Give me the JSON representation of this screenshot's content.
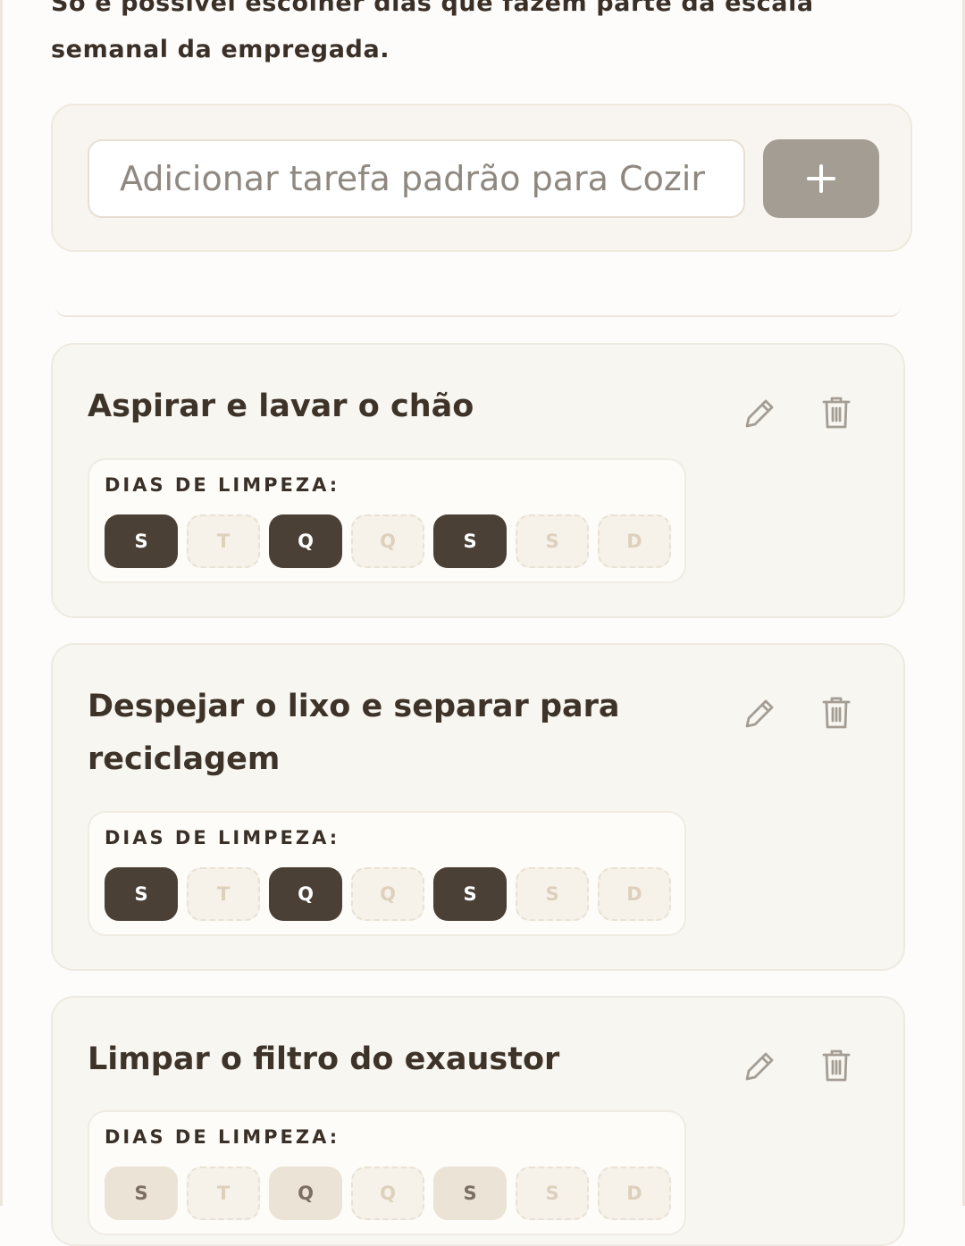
{
  "instructions": {
    "note": "Só é possível escolher dias que fazem parte da escala semanal da empregada."
  },
  "add_task": {
    "placeholder": "Adicionar tarefa padrão para Cozir",
    "button_icon": "plus-icon"
  },
  "colors": {
    "selected_day": "#4b4036",
    "unselected_day": "#f6f2ea",
    "add_button": "#a39d94",
    "card_background": "#f8f6f1"
  },
  "tasks": [
    {
      "title": "Aspirar e lavar o chão",
      "days_label": "DIAS DE LIMPEZA:",
      "days": [
        {
          "letter": "S",
          "state": "selected"
        },
        {
          "letter": "T",
          "state": "unavailable"
        },
        {
          "letter": "Q",
          "state": "selected"
        },
        {
          "letter": "Q",
          "state": "unavailable"
        },
        {
          "letter": "S",
          "state": "selected"
        },
        {
          "letter": "S",
          "state": "unavailable"
        },
        {
          "letter": "D",
          "state": "unavailable"
        }
      ]
    },
    {
      "title": "Despejar o lixo e separar para reciclagem",
      "days_label": "DIAS DE LIMPEZA:",
      "days": [
        {
          "letter": "S",
          "state": "selected"
        },
        {
          "letter": "T",
          "state": "unavailable"
        },
        {
          "letter": "Q",
          "state": "selected"
        },
        {
          "letter": "Q",
          "state": "unavailable"
        },
        {
          "letter": "S",
          "state": "selected"
        },
        {
          "letter": "S",
          "state": "unavailable"
        },
        {
          "letter": "D",
          "state": "unavailable"
        }
      ]
    },
    {
      "title": "Limpar o filtro do exaustor",
      "days_label": "DIAS DE LIMPEZA:",
      "days": [
        {
          "letter": "S",
          "state": "available"
        },
        {
          "letter": "T",
          "state": "unavailable"
        },
        {
          "letter": "Q",
          "state": "available"
        },
        {
          "letter": "Q",
          "state": "unavailable"
        },
        {
          "letter": "S",
          "state": "available"
        },
        {
          "letter": "S",
          "state": "unavailable"
        },
        {
          "letter": "D",
          "state": "unavailable"
        }
      ]
    }
  ]
}
